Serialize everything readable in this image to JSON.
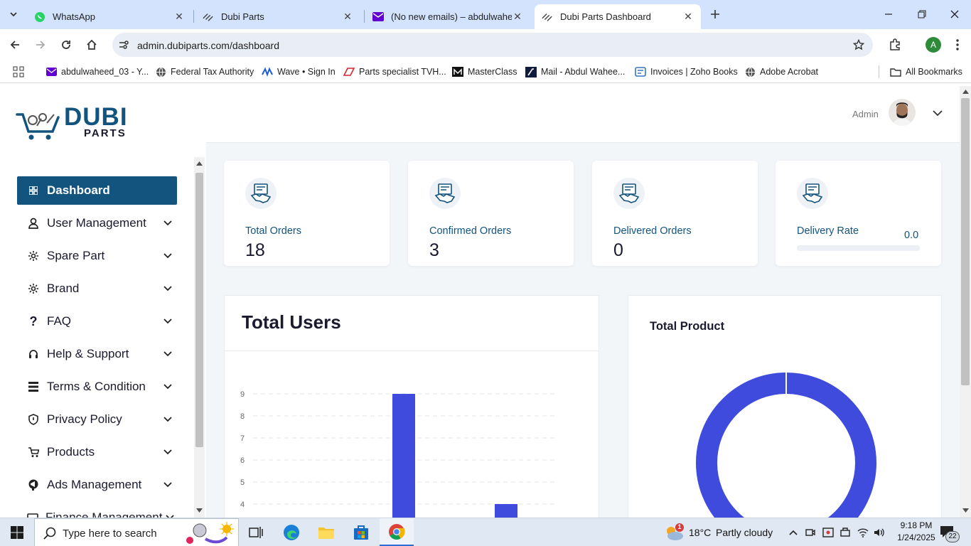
{
  "browser": {
    "tabs": [
      {
        "title": "WhatsApp",
        "icon": "whatsapp-icon"
      },
      {
        "title": "Dubi Parts",
        "icon": "dubi-parts-icon"
      },
      {
        "title": "(No new emails) – abdulwaheed",
        "icon": "yahoo-mail-icon"
      },
      {
        "title": "Dubi Parts Dashboard",
        "icon": "dubi-parts-icon"
      }
    ],
    "url": "admin.dubiparts.com/dashboard",
    "profile_initial": "A",
    "bookmarks": [
      {
        "label": "abdulwaheed_03 - Y...",
        "icon": "yahoo-mail-icon"
      },
      {
        "label": "Federal Tax Authority",
        "icon": "globe-icon"
      },
      {
        "label": "Wave • Sign In",
        "icon": "wave-icon"
      },
      {
        "label": "Parts specialist TVH...",
        "icon": "tvh-icon"
      },
      {
        "label": "MasterClass",
        "icon": "masterclass-icon"
      },
      {
        "label": "Mail - Abdul Wahee...",
        "icon": "outlook-icon"
      },
      {
        "label": "Invoices | Zoho Books",
        "icon": "zoho-icon"
      },
      {
        "label": "Adobe Acrobat",
        "icon": "globe-icon"
      }
    ],
    "all_bookmarks": "All Bookmarks"
  },
  "brand": {
    "name": "DUBI",
    "sub": "PARTS"
  },
  "header": {
    "user_label": "Admin"
  },
  "sidebar": {
    "items": [
      {
        "label": "Dashboard",
        "icon": "dashboard-icon"
      },
      {
        "label": "User Management",
        "icon": "user-icon"
      },
      {
        "label": "Spare Part",
        "icon": "gear-icon"
      },
      {
        "label": "Brand",
        "icon": "gear-icon"
      },
      {
        "label": "FAQ",
        "icon": "question-icon"
      },
      {
        "label": "Help & Support",
        "icon": "headset-icon"
      },
      {
        "label": "Terms & Condition",
        "icon": "list-icon"
      },
      {
        "label": "Privacy Policy",
        "icon": "shield-icon"
      },
      {
        "label": "Products",
        "icon": "cart-icon"
      },
      {
        "label": "Ads Management",
        "icon": "megaphone-icon"
      },
      {
        "label": "Finance Management",
        "icon": "finance-icon"
      }
    ]
  },
  "stats": [
    {
      "label": "Total Orders",
      "value": "18"
    },
    {
      "label": "Confirmed Orders",
      "value": "3"
    },
    {
      "label": "Delivered Orders",
      "value": "0"
    },
    {
      "label": "Delivery Rate",
      "value": "0.0",
      "progress": 0
    }
  ],
  "users_panel": {
    "title": "Total Users"
  },
  "product_panel": {
    "title": "Total Product"
  },
  "chart_data": [
    {
      "type": "bar",
      "title": "Total Users",
      "yticks": [
        "9",
        "8",
        "7",
        "6",
        "5",
        "4"
      ],
      "ylim": [
        4,
        9
      ],
      "values": [
        9,
        4
      ],
      "grid": true
    },
    {
      "type": "pie",
      "title": "Total Product",
      "values": [
        100
      ],
      "colors": [
        "#3f4bdc"
      ]
    }
  ],
  "taskbar": {
    "search_placeholder": "Type here to search",
    "weather_temp": "18°C",
    "weather_text": "Partly cloudy",
    "weather_badge": "1",
    "time": "9:18 PM",
    "date": "1/24/2025",
    "notification_count": "22"
  }
}
